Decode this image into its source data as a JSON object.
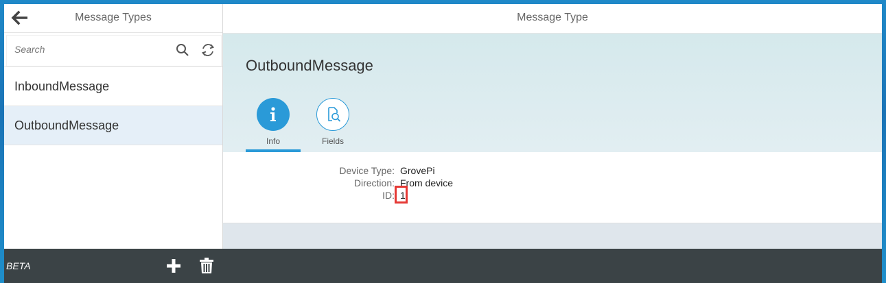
{
  "master": {
    "title": "Message Types",
    "search_placeholder": "Search",
    "items": [
      {
        "label": "InboundMessage",
        "selected": false
      },
      {
        "label": "OutboundMessage",
        "selected": true
      }
    ]
  },
  "detail": {
    "header_title": "Message Type",
    "object_title": "OutboundMessage",
    "tabs": [
      {
        "label": "Info",
        "icon": "info-icon",
        "active": true
      },
      {
        "label": "Fields",
        "icon": "document-search-icon",
        "active": false
      }
    ],
    "fields": {
      "device_type": {
        "label": "Device Type:",
        "value": "GrovePi"
      },
      "direction": {
        "label": "Direction:",
        "value": "From device"
      },
      "id": {
        "label": "ID:",
        "value": "1"
      }
    }
  },
  "footer": {
    "beta_label": "BETA",
    "add_icon": "plus-icon",
    "delete_icon": "trash-icon"
  },
  "colors": {
    "accent": "#2a9ad8",
    "footer_bg": "#3b4346",
    "selected_bg": "#e5eff8",
    "highlight_box": "#e53935"
  }
}
